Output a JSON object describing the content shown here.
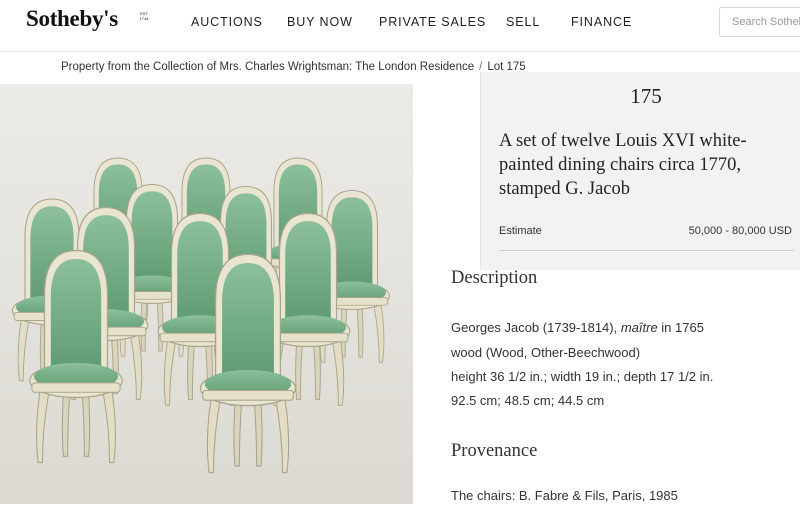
{
  "header": {
    "logo_text": "Sotheby's",
    "logo_est": [
      "EST",
      "1744"
    ],
    "nav": [
      "AUCTIONS",
      "BUY NOW",
      "PRIVATE SALES",
      "SELL",
      "FINANCE"
    ],
    "search_placeholder": "Search Sotheby's"
  },
  "breadcrumb": {
    "collection": "Property from the Collection of Mrs. Charles Wrightsman: The London Residence",
    "separator": "/",
    "lot": "Lot 175"
  },
  "lot": {
    "number": "175",
    "title": "A set of twelve Louis XVI white-painted dining chairs circa 1770, stamped G. Jacob",
    "estimate_label": "Estimate",
    "estimate_value": "50,000 - 80,000 USD"
  },
  "image": {
    "alt_icon": "chairs-photo",
    "colors": {
      "upholstery": "#7fb48e",
      "frame": "#e7e3cf",
      "background": "#e9e7e2"
    }
  },
  "description": {
    "heading": "Description",
    "maker_name": "Georges Jacob (1739-1814), ",
    "maker_title": "maître",
    "maker_suffix": " in 1765",
    "material": "wood (Wood, Other-Beechwood)",
    "dimensions_in": "height 36 1/2 in.; width 19 in.; depth 17 1/2 in.",
    "dimensions_cm": "92.5 cm; 48.5 cm; 44.5 cm"
  },
  "provenance": {
    "heading": "Provenance",
    "line1": "The chairs: B. Fabre & Fils, Paris, 1985"
  }
}
